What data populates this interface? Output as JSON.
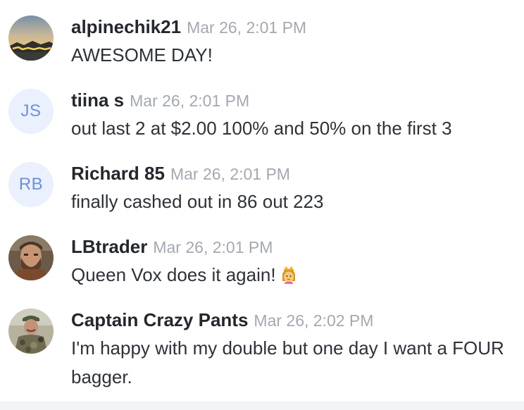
{
  "messages": [
    {
      "username": "alpinechik21",
      "timestamp": "Mar 26, 2:01 PM",
      "text": "AWESOME DAY!",
      "avatar": {
        "type": "image",
        "icon": "sunset-mountain-photo"
      }
    },
    {
      "username": "tiina s",
      "timestamp": "Mar 26, 2:01 PM",
      "text": "out last 2 at $2.00 100% and 50% on the first 3",
      "avatar": {
        "type": "initials",
        "initials": "JS"
      }
    },
    {
      "username": "Richard 85",
      "timestamp": "Mar 26, 2:01 PM",
      "text": "finally cashed out in 86 out 223",
      "avatar": {
        "type": "initials",
        "initials": "RB"
      }
    },
    {
      "username": "LBtrader",
      "timestamp": "Mar 26, 2:01 PM",
      "text": "Queen Vox does it again!",
      "emoji": "princess-emoji",
      "avatar": {
        "type": "image",
        "icon": "bearded-man-photo"
      }
    },
    {
      "username": "Captain Crazy Pants",
      "timestamp": "Mar 26, 2:02 PM",
      "text": "I'm happy with my double but one day I want a FOUR bagger.",
      "avatar": {
        "type": "image",
        "icon": "camo-hunter-photo"
      }
    }
  ],
  "colors": {
    "username": "#24272d",
    "timestamp": "#a4a8b0",
    "text": "#2e3238",
    "initials_bg": "#eaf1fd",
    "initials_fg": "#6f8fd6"
  }
}
